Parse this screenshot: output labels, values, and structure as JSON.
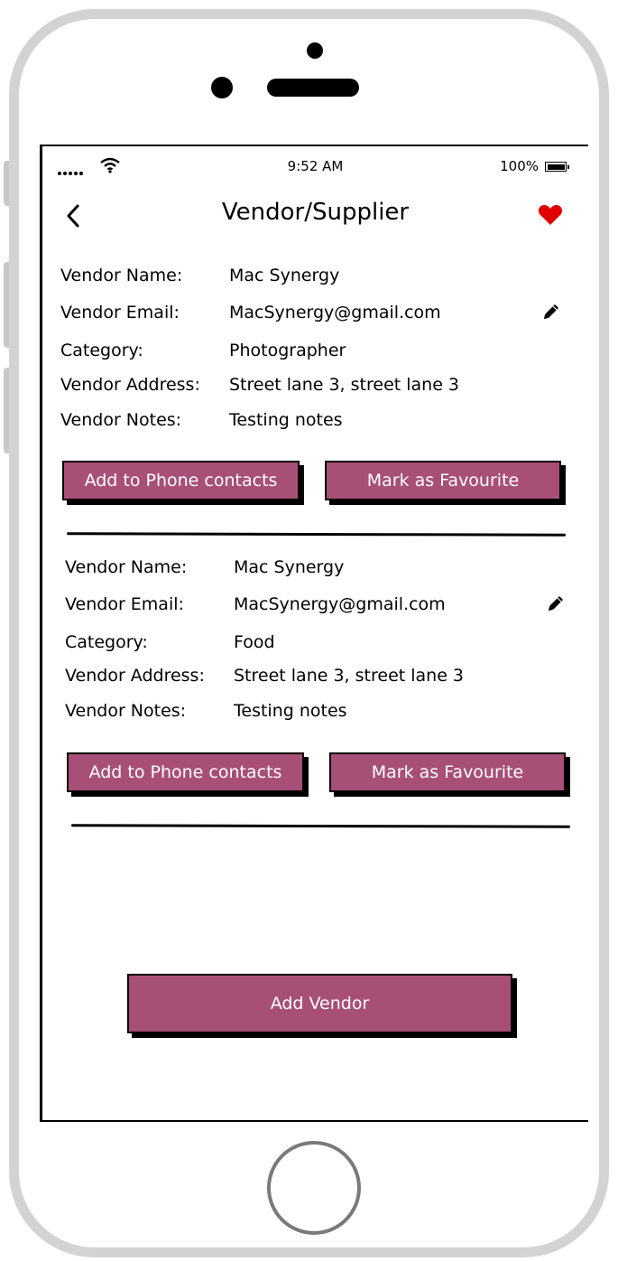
{
  "status_bar": {
    "time": "9:52 AM",
    "battery": "100%"
  },
  "nav": {
    "title": "Vendor/Supplier"
  },
  "labels": {
    "name": "Vendor Name:",
    "email": "Vendor Email:",
    "category": "Category:",
    "address": "Vendor Address:",
    "notes": "Vendor Notes:"
  },
  "vendors": [
    {
      "name": "Mac Synergy",
      "email": "MacSynergy@gmail.com",
      "category": "Photographer",
      "address": "Street lane 3, street lane 3",
      "notes": "Testing notes",
      "add_contacts_label": "Add  to Phone contacts",
      "favourite_label": "Mark as Favourite"
    },
    {
      "name": "Mac Synergy",
      "email": "MacSynergy@gmail.com",
      "category": "Food",
      "address": "Street lane 3, street lane 3",
      "notes": "Testing notes",
      "add_contacts_label": "Add  to Phone contacts",
      "favourite_label": "Mark as Favourite"
    }
  ],
  "add_vendor_label": "Add Vendor",
  "colors": {
    "accent": "#a84f78",
    "heart": "#e00000",
    "frame": "#d3d3d3"
  },
  "icons": [
    "signal-icon",
    "wifi-icon",
    "battery-icon",
    "back-chevron-icon",
    "heart-icon",
    "pencil-icon"
  ]
}
